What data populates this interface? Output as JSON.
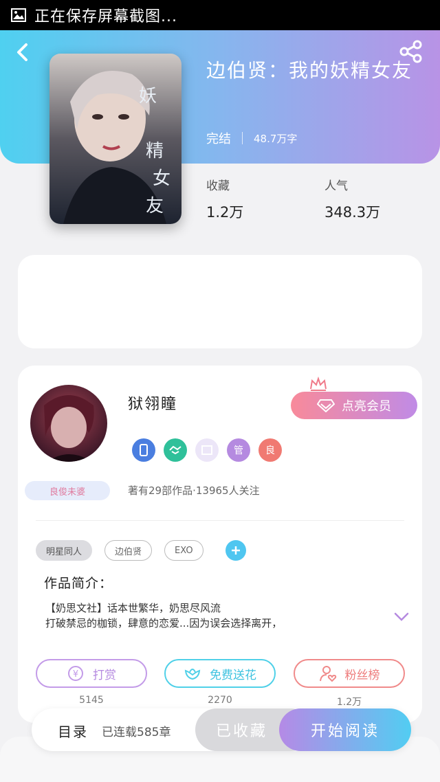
{
  "statusbar": {
    "title": "正在保存屏幕截图..."
  },
  "book": {
    "title": "边伯贤：我的妖精女友",
    "status": "完结",
    "words": "48.7万字",
    "collect_label": "收藏",
    "collect_value": "1.2万",
    "popularity_label": "人气",
    "popularity_value": "348.3万"
  },
  "author": {
    "name": "狱翎瞳",
    "vip_label": "点亮会员",
    "tag": "良俊未婆",
    "stats": "著有29部作品·13965人关注",
    "badges": [
      "",
      "",
      "",
      "管",
      "良"
    ]
  },
  "tags": [
    "明星同人",
    "边伯贤",
    "EXO"
  ],
  "intro": {
    "title": "作品简介：",
    "line1": "【奶思文社】话本世繁华，奶思尽风流",
    "line2": "打破禁忌的枷锁，肆意的恋爱...因为误会选择离开，"
  },
  "actions": [
    {
      "label": "打赏",
      "count": "5145",
      "color": "#c39be8"
    },
    {
      "label": "免费送花",
      "count": "2270",
      "color": "#4fd0e8"
    },
    {
      "label": "粉丝榜",
      "count": "1.2万",
      "color": "#f08a8a"
    }
  ],
  "bottom": {
    "toc_label": "目录",
    "chapters": "已连载585章",
    "collected_label": "已收藏",
    "read_label": "开始阅读"
  }
}
